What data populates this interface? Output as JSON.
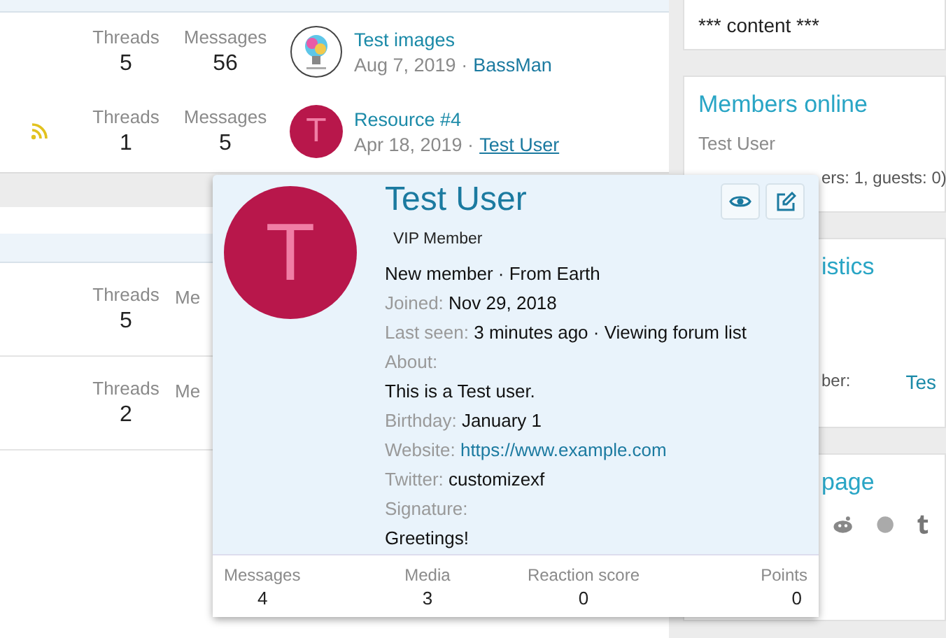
{
  "forum_rows": [
    {
      "feed": false,
      "stats": [
        {
          "label": "Threads",
          "value": "5"
        },
        {
          "label": "Messages",
          "value": "56"
        }
      ],
      "latest": {
        "title": "Test images",
        "date": "Aug 7, 2019 ·",
        "user": "BassMan",
        "hovered": false
      }
    },
    {
      "feed": true,
      "stats": [
        {
          "label": "Threads",
          "value": "1"
        },
        {
          "label": "Messages",
          "value": "5"
        }
      ],
      "latest": {
        "avatar": {
          "kind": "letter",
          "letter": "T"
        },
        "title": "Resource #4",
        "date": "Apr 18, 2019 ·",
        "user": "Test User",
        "hovered": true
      }
    }
  ],
  "lower_rows": [
    {
      "stats": [
        {
          "label": "Threads",
          "value": "5"
        },
        {
          "label": "Me"
        }
      ]
    },
    {
      "stats": [
        {
          "label": "Threads",
          "value": "2"
        },
        {
          "label": "Me"
        }
      ]
    }
  ],
  "sidebar": [
    {
      "kind": "text",
      "text": "*** content ***"
    },
    {
      "kind": "members",
      "title": "Members online",
      "member": "Test User",
      "totals": "ers: 1, guests: 0)"
    },
    {
      "kind": "stats",
      "title": "istics",
      "label": "ber:",
      "value": "Tes"
    },
    {
      "kind": "share",
      "title": "page"
    }
  ],
  "member_tooltip": {
    "letter": "T",
    "name": "Test User",
    "banner": "VIP Member",
    "blurb": "New member · From Earth",
    "lines": [
      {
        "kind": "inline",
        "label": "Joined:",
        "value": "Nov 29, 2018"
      },
      {
        "kind": "inline",
        "label": "Last seen:",
        "value": "3 minutes ago · Viewing forum list"
      },
      {
        "kind": "block",
        "label": "About:",
        "value": "This is a Test user."
      },
      {
        "kind": "inline",
        "label": "Birthday:",
        "value": "January 1"
      },
      {
        "kind": "link",
        "label": "Website:",
        "value": "https://www.example.com"
      },
      {
        "kind": "inline",
        "label": "Twitter:",
        "value": "customizexf"
      },
      {
        "kind": "block",
        "label": "Signature:",
        "value": "Greetings!"
      }
    ],
    "stats": [
      {
        "label": "Messages",
        "value": "4"
      },
      {
        "label": "Media",
        "value": "3"
      },
      {
        "label": "Reaction score",
        "value": "0"
      },
      {
        "label": "Points",
        "value": "0"
      }
    ]
  }
}
